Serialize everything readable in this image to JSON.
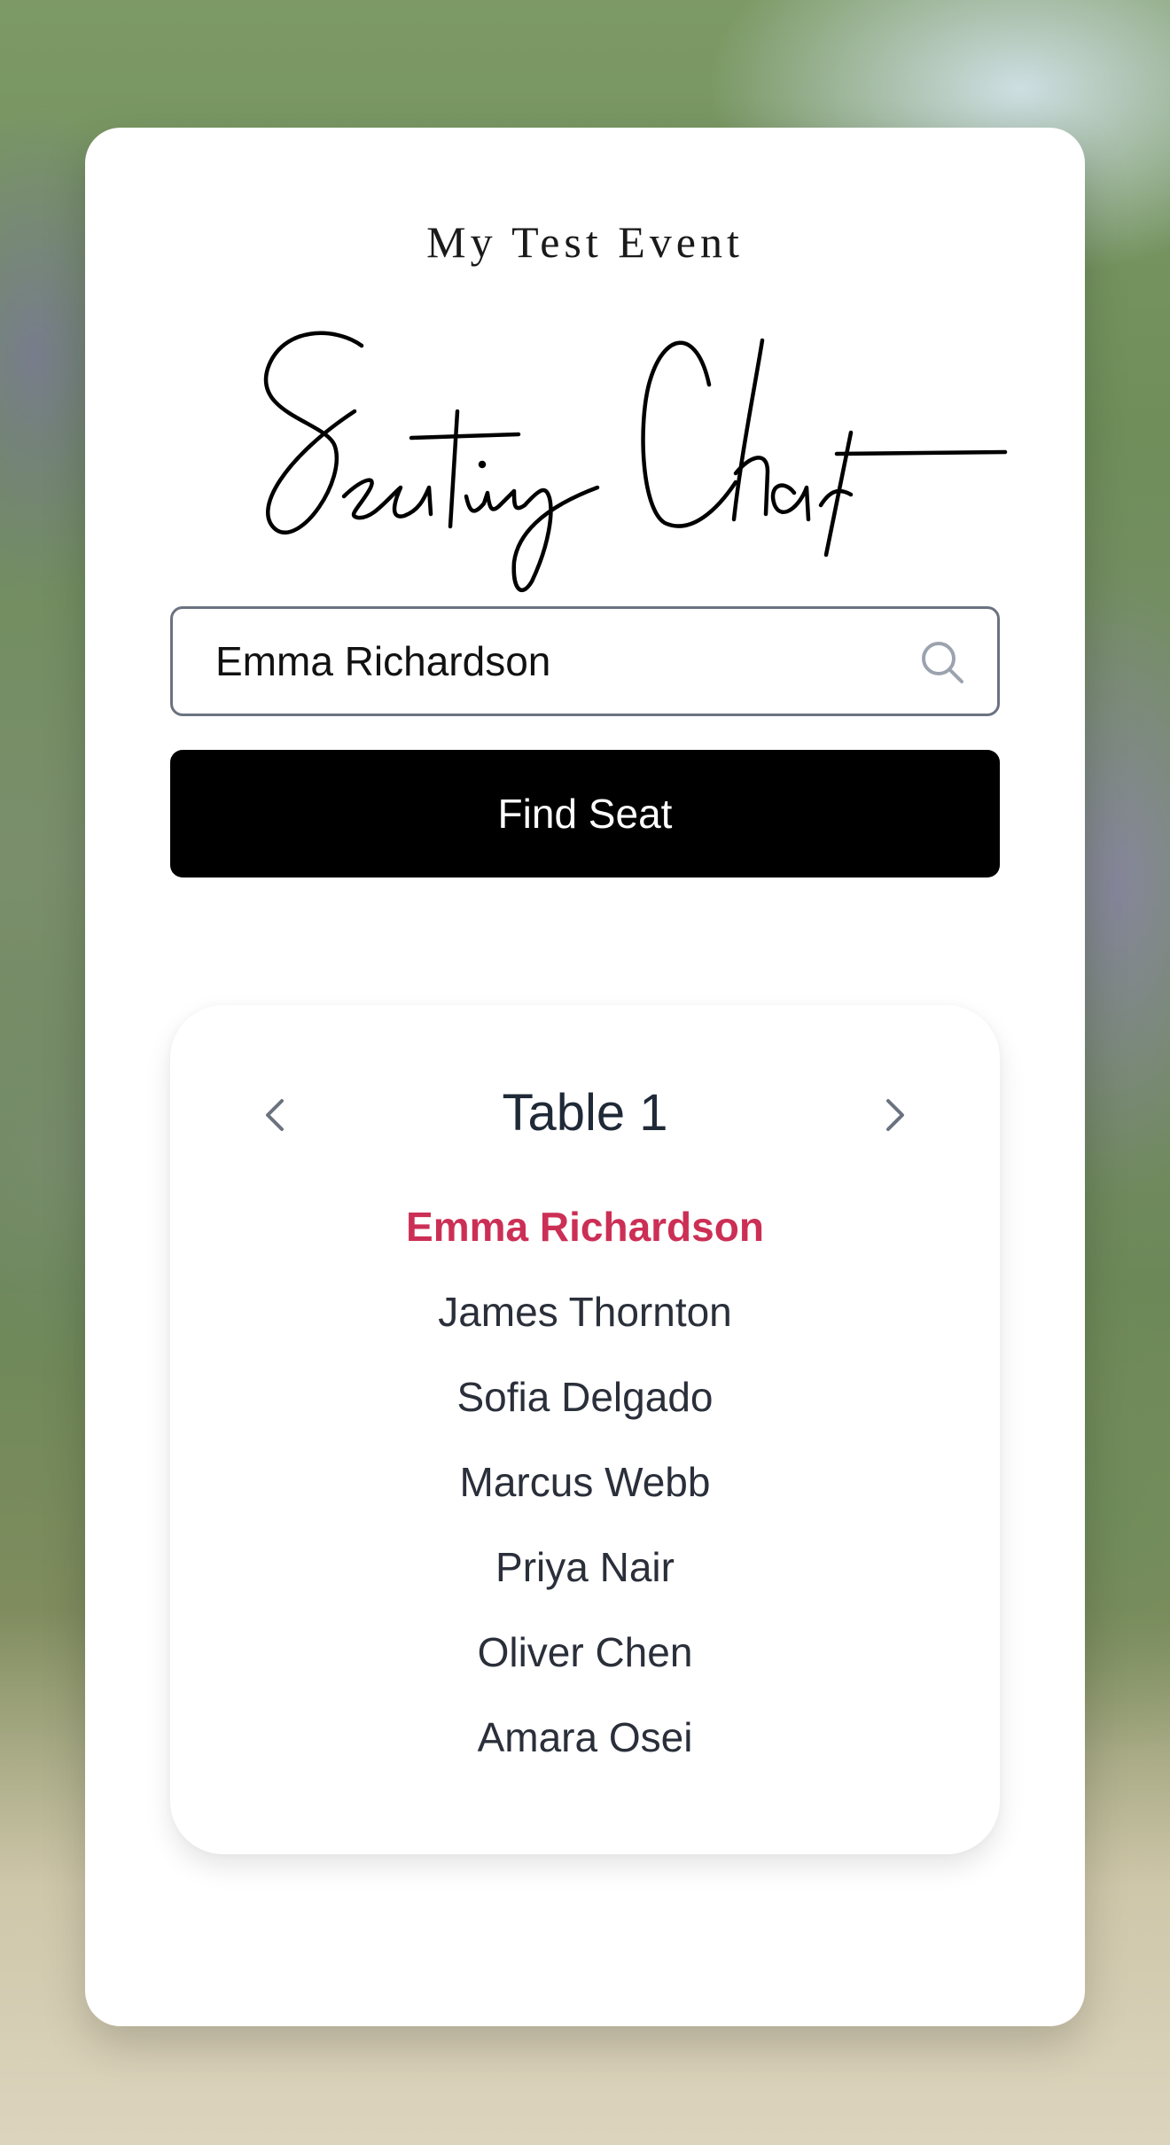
{
  "event": {
    "name": "My Test Event",
    "title": "Seating Chart"
  },
  "search": {
    "value": "Emma Richardson",
    "icon": "search-icon"
  },
  "find_button": {
    "label": "Find Seat"
  },
  "table": {
    "name": "Table 1",
    "prev_icon": "chevron-left-icon",
    "next_icon": "chevron-right-icon",
    "guests": [
      "Emma Richardson",
      "James Thornton",
      "Sofia Delgado",
      "Marcus Webb",
      "Priya Nair",
      "Oliver Chen",
      "Amara Osei"
    ],
    "highlighted_guest_index": 0
  },
  "colors": {
    "button_bg": "#000000",
    "highlight": "#cc2f55",
    "text": "#2a2f3a"
  }
}
